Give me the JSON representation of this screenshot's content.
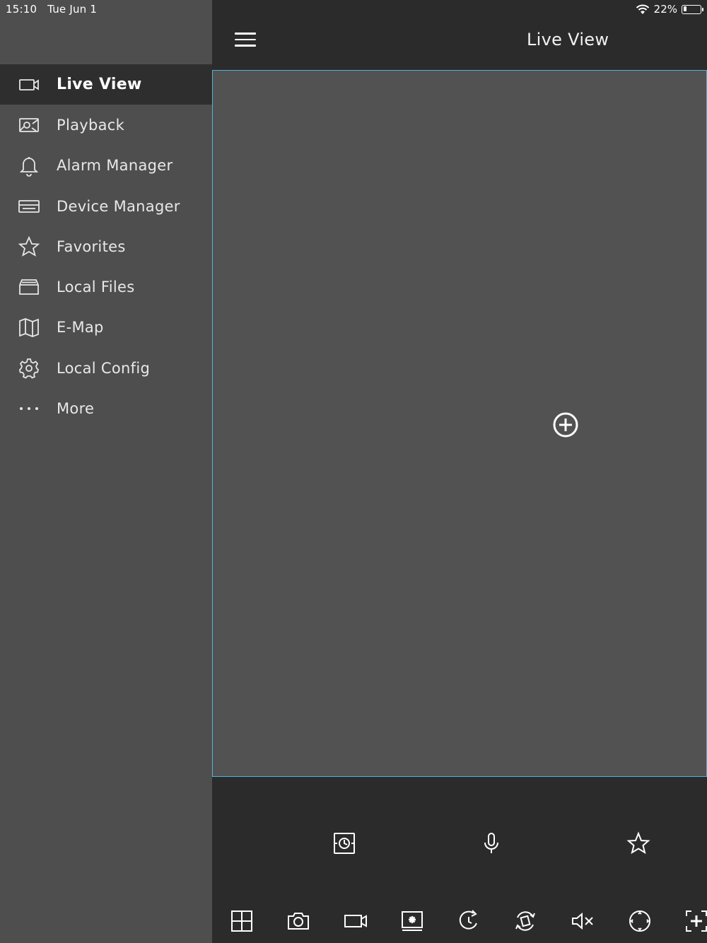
{
  "status_bar": {
    "time": "15:10",
    "date": "Tue Jun 1",
    "battery": "22%",
    "battery_level": 0.22
  },
  "header": {
    "title": "Live View"
  },
  "sidebar": {
    "items": [
      {
        "label": "Live View",
        "icon": "video-camera-icon",
        "active": true
      },
      {
        "label": "Playback",
        "icon": "playback-icon",
        "active": false
      },
      {
        "label": "Alarm Manager",
        "icon": "bell-icon",
        "active": false
      },
      {
        "label": "Device Manager",
        "icon": "device-icon",
        "active": false
      },
      {
        "label": "Favorites",
        "icon": "star-icon",
        "active": false
      },
      {
        "label": "Local Files",
        "icon": "folder-icon",
        "active": false
      },
      {
        "label": "E-Map",
        "icon": "map-icon",
        "active": false
      },
      {
        "label": "Local Config",
        "icon": "gear-icon",
        "active": false
      },
      {
        "label": "More",
        "icon": "more-dots-icon",
        "active": false
      }
    ]
  },
  "main": {
    "add_camera_icon": "plus-circle-icon"
  },
  "toolbar_top": [
    "instant-playback-icon",
    "microphone-icon",
    "star-icon"
  ],
  "toolbar_bottom": [
    "grid-layout-icon",
    "snapshot-camera-icon",
    "record-video-icon",
    "screen-capture-icon",
    "refresh-icon",
    "rotate-icon",
    "mute-icon",
    "ptz-icon",
    "fullscreen-icon"
  ],
  "colors": {
    "sidebar_bg": "#4e4e4e",
    "active_bg": "#2e2e2e",
    "panel_bg": "#525252",
    "panel_border": "#4fb3d9",
    "app_bg": "#2b2b2b"
  }
}
